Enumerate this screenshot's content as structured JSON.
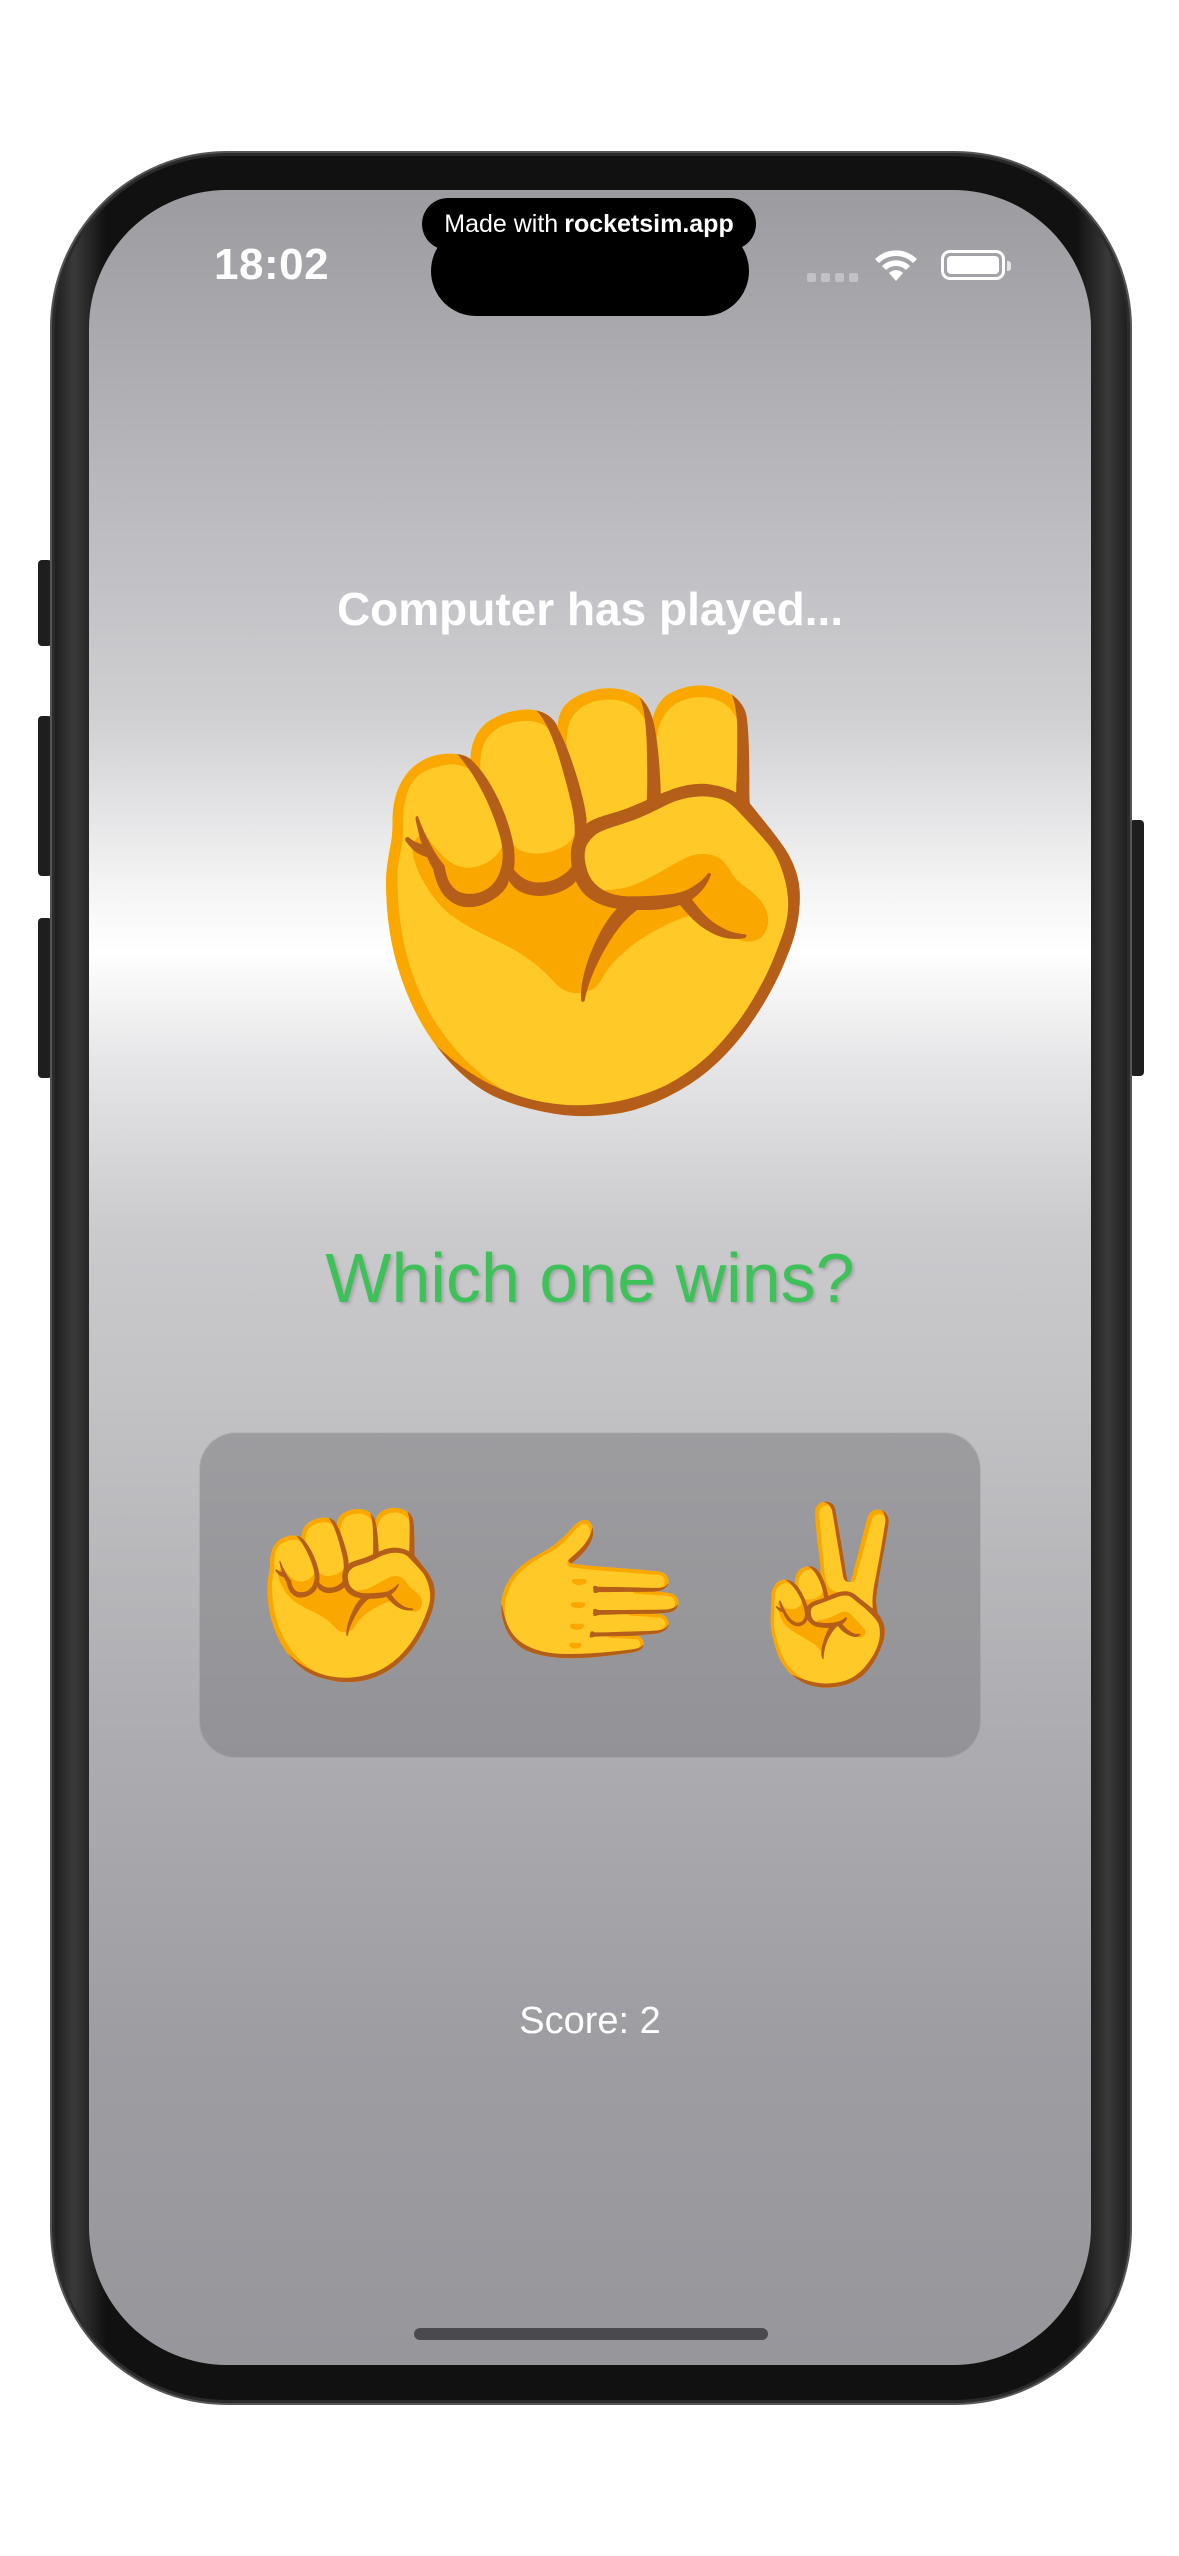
{
  "status_bar": {
    "time": "18:02",
    "banner_prefix": "Made with",
    "banner_brand": "rocketsim.app"
  },
  "game": {
    "prompt": "Computer has played...",
    "computer_move": "✊",
    "question": "Which one wins?",
    "choices": [
      {
        "emoji": "✊",
        "name": "rock"
      },
      {
        "emoji": "🫱",
        "name": "paper"
      },
      {
        "emoji": "✌️",
        "name": "scissors"
      }
    ],
    "score": "Score: 2"
  },
  "colors": {
    "question": "#3fc15a",
    "text": "#ffffff",
    "panel": "#8a8a8e"
  }
}
